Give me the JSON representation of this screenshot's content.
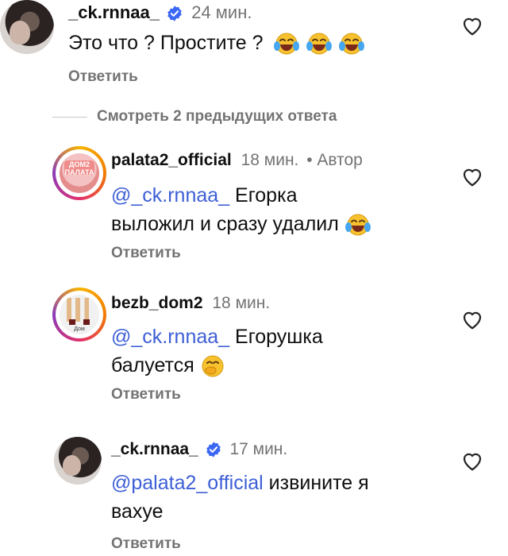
{
  "comments": [
    {
      "username": "_ck.rnnaa_",
      "verified": true,
      "time": "24 мин.",
      "text": "Это что ? Простите ?",
      "emoji": [
        "face-with-tears-of-joy",
        "face-with-tears-of-joy",
        "face-with-tears-of-joy"
      ],
      "reply_label": "Ответить"
    }
  ],
  "view_replies": "Смотреть 2 предыдущих ответа",
  "replies": [
    {
      "username": "palata2_official",
      "time": "18 мин.",
      "author_tag": "• Автор",
      "mention": "@_ck.rnnaa_",
      "text_line1": "Егорка",
      "text_line2": "выложил и сразу удалил",
      "emoji": "face-with-tears-of-joy",
      "reply_label": "Ответить",
      "avatar_text": "ДОМ2 ПАЛАТА"
    },
    {
      "username": "bezb_dom2",
      "time": "18 мин.",
      "mention": "@_ck.rnnaa_",
      "text_line1": "Егорушка",
      "text_line2": "балуется",
      "emoji": "face-with-hand-over-mouth",
      "reply_label": "Ответить",
      "avatar_text": "Дом"
    },
    {
      "username": "_ck.rnnaa_",
      "verified": true,
      "time": "17 мин.",
      "mention": "@palata2_official",
      "text_line1": "извините я",
      "text_line2": "вахуе",
      "reply_label": "Ответить"
    }
  ],
  "colors": {
    "mention": "#3d5fd6",
    "verified": "#3b67f5",
    "meta": "#737373"
  }
}
